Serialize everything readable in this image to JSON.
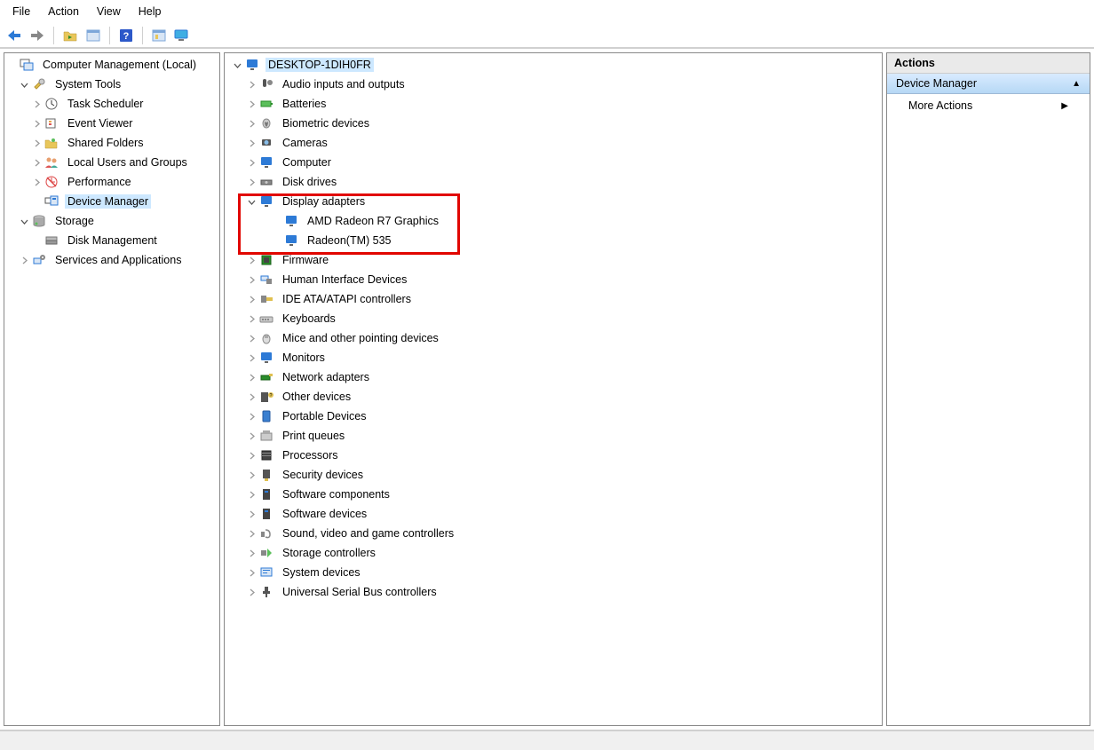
{
  "menubar": {
    "file": "File",
    "action": "Action",
    "view": "View",
    "help": "Help"
  },
  "leftTree": {
    "root": "Computer Management (Local)",
    "systemTools": "System Tools",
    "taskScheduler": "Task Scheduler",
    "eventViewer": "Event Viewer",
    "sharedFolders": "Shared Folders",
    "localUsers": "Local Users and Groups",
    "performance": "Performance",
    "deviceManager": "Device Manager",
    "storage": "Storage",
    "diskManagement": "Disk Management",
    "servicesApps": "Services and Applications"
  },
  "deviceTree": {
    "host": "DESKTOP-1DIH0FR",
    "items": [
      "Audio inputs and outputs",
      "Batteries",
      "Biometric devices",
      "Cameras",
      "Computer",
      "Disk drives",
      "Display adapters",
      "Firmware",
      "Human Interface Devices",
      "IDE ATA/ATAPI controllers",
      "Keyboards",
      "Mice and other pointing devices",
      "Monitors",
      "Network adapters",
      "Other devices",
      "Portable Devices",
      "Print queues",
      "Processors",
      "Security devices",
      "Software components",
      "Software devices",
      "Sound, video and game controllers",
      "Storage controllers",
      "System devices",
      "Universal Serial Bus controllers"
    ],
    "displayExpandedIndex": 6,
    "displayChildren": [
      "AMD Radeon R7 Graphics",
      "Radeon(TM) 535"
    ]
  },
  "actions": {
    "header": "Actions",
    "section": "Device Manager",
    "more": "More Actions"
  }
}
